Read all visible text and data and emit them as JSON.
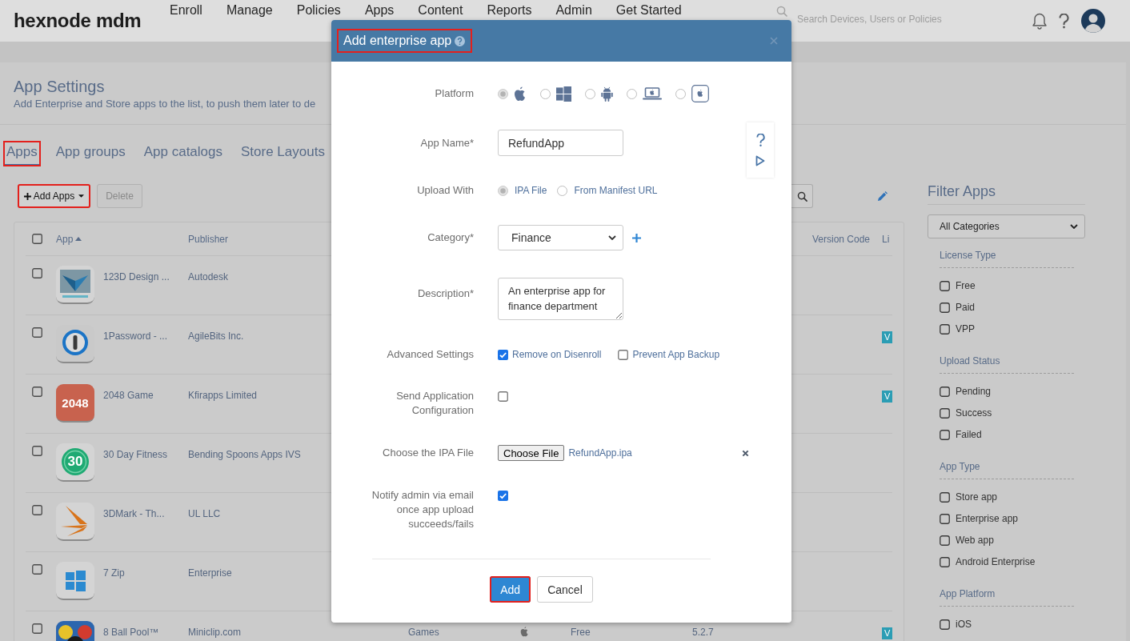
{
  "header": {
    "logo": "hexnode mdm",
    "nav": [
      {
        "label": "Enroll"
      },
      {
        "label": "Manage"
      },
      {
        "label": "Policies"
      },
      {
        "label": "Apps"
      },
      {
        "label": "Content"
      },
      {
        "label": "Reports"
      },
      {
        "label": "Admin"
      },
      {
        "label": "Get Started"
      }
    ],
    "search": {
      "placeholder": "Search Devices, Users or Policies"
    }
  },
  "page": {
    "title": "App Settings",
    "subtitle": "Add Enterprise and Store apps to the list, to push them later to de"
  },
  "tabs": [
    {
      "label": "Apps",
      "selected": true,
      "highlighted": true
    },
    {
      "label": "App groups",
      "selected": false,
      "highlighted": false
    },
    {
      "label": "App catalogs",
      "selected": false,
      "highlighted": false
    },
    {
      "label": "Store Layouts",
      "selected": false,
      "highlighted": false
    }
  ],
  "toolbar": {
    "add_button": {
      "label": "Add Apps",
      "highlighted": true
    },
    "delete_button": {
      "label": "Delete",
      "disabled": true
    }
  },
  "table": {
    "header_checked": false,
    "columns": [
      {
        "label": "App",
        "sorted": true
      },
      {
        "label": "Publisher",
        "sorted": false
      },
      {
        "label": "Version Code",
        "sorted": false
      },
      {
        "label": "Li",
        "sorted": false
      }
    ],
    "rows": [
      {
        "checked": false,
        "name": "123D Design ...",
        "publisher": "Autodesk"
      },
      {
        "checked": false,
        "name": "1Password - ...",
        "publisher": "AgileBits Inc.",
        "badge": "V"
      },
      {
        "checked": false,
        "name": "2048 Game",
        "publisher": "Kfirapps Limited",
        "icon_text": "2048",
        "badge": "V"
      },
      {
        "checked": false,
        "name": "30 Day Fitness",
        "publisher": "Bending Spoons Apps IVS",
        "icon_text": "30"
      },
      {
        "checked": false,
        "name": "3DMark - Th...",
        "publisher": "UL LLC"
      },
      {
        "checked": false,
        "name": "7 Zip",
        "publisher": "Enterprise"
      },
      {
        "checked": false,
        "name": "8 Ball Pool™",
        "publisher": "Miniclip.com",
        "category": "Games",
        "license": "Free",
        "version": "5.2.7",
        "badge": "V"
      }
    ]
  },
  "filter": {
    "title": "Filter Apps",
    "category": "All Categories",
    "sections": [
      {
        "title": "License Type",
        "options": [
          {
            "label": "Free",
            "checked": false
          },
          {
            "label": "Paid",
            "checked": false
          },
          {
            "label": "VPP",
            "checked": false
          }
        ]
      },
      {
        "title": "Upload Status",
        "options": [
          {
            "label": "Pending",
            "checked": false
          },
          {
            "label": "Success",
            "checked": false
          },
          {
            "label": "Failed",
            "checked": false
          }
        ]
      },
      {
        "title": "App Type",
        "options": [
          {
            "label": "Store app",
            "checked": false
          },
          {
            "label": "Enterprise app",
            "checked": false
          },
          {
            "label": "Web app",
            "checked": false
          },
          {
            "label": "Android Enterprise",
            "checked": false
          }
        ]
      },
      {
        "title": "App Platform",
        "options": [
          {
            "label": "iOS",
            "checked": false
          }
        ]
      }
    ]
  },
  "modal": {
    "title": "Add enterprise app",
    "highlighted": true,
    "fields": [
      {
        "kind": "platform",
        "label": "Platform",
        "options": [
          {
            "selected": true
          },
          {
            "selected": false
          },
          {
            "selected": false
          },
          {
            "selected": false
          },
          {
            "selected": false
          }
        ]
      },
      {
        "kind": "text",
        "label": "App Name*",
        "value": "RefundApp"
      },
      {
        "kind": "radio",
        "label": "Upload With",
        "options": [
          {
            "label": "IPA File",
            "selected": true
          },
          {
            "label": "From Manifest URL",
            "selected": false
          }
        ]
      },
      {
        "kind": "select",
        "label": "Category*",
        "value": "Finance"
      },
      {
        "kind": "textarea",
        "label": "Description*",
        "value": "An enterprise app for finance department"
      },
      {
        "kind": "checks",
        "label": "Advanced Settings",
        "options": [
          {
            "label": "Remove on Disenroll",
            "checked": true
          },
          {
            "label": "Prevent App Backup",
            "checked": false
          }
        ]
      },
      {
        "kind": "checkbox",
        "label": "Send Application Configuration",
        "checked": false
      },
      {
        "kind": "file",
        "label": "Choose the IPA File",
        "button": "Choose File",
        "file_name": "RefundApp.ipa"
      },
      {
        "kind": "checkbox",
        "label": "Notify admin via email once app upload succeeds/fails",
        "checked": true
      }
    ],
    "buttons": [
      {
        "label": "Add",
        "kind": "primary",
        "highlighted": true
      },
      {
        "label": "Cancel",
        "kind": "secondary",
        "highlighted": false
      }
    ]
  }
}
